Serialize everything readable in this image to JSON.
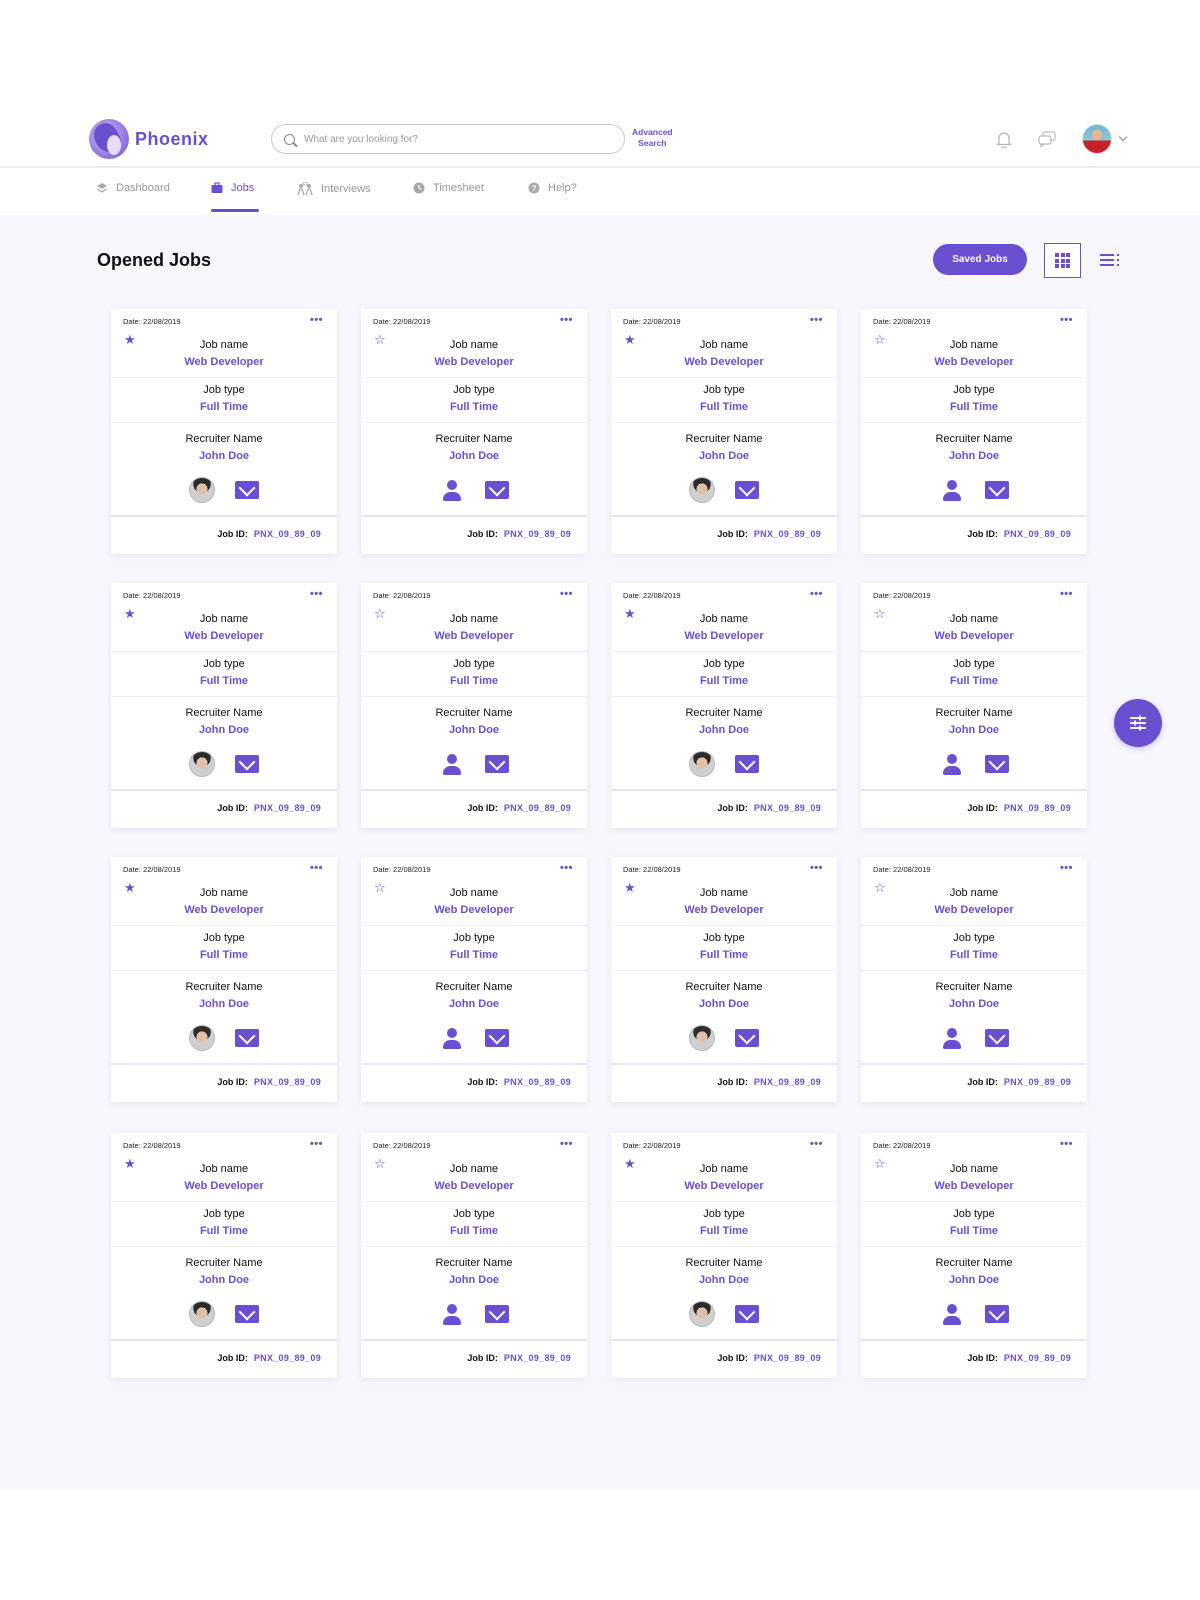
{
  "app": {
    "name": "Phoenix"
  },
  "header": {
    "search_placeholder": "What are you looking for?",
    "advanced_search_line1": "Advanced",
    "advanced_search_line2": "Search",
    "icons": [
      "bell-icon",
      "chat-icon",
      "user-avatar",
      "chevron-down-icon"
    ]
  },
  "nav": {
    "items": [
      {
        "label": "Dashboard",
        "icon": "layers-icon",
        "active": false
      },
      {
        "label": "Jobs",
        "icon": "briefcase-icon",
        "active": true
      },
      {
        "label": "Interviews",
        "icon": "interview-icon",
        "active": false
      },
      {
        "label": "Timesheet",
        "icon": "clock-icon",
        "active": false
      },
      {
        "label": "Help?",
        "icon": "help-icon",
        "active": false
      }
    ]
  },
  "page": {
    "title": "Opened Jobs",
    "saved_jobs_label": "Saved Jobs",
    "view_modes": [
      "grid",
      "list"
    ],
    "active_view": "grid"
  },
  "card_labels": {
    "date_prefix": "Date:",
    "job_name": "Job name",
    "job_type": "Job type",
    "recruiter_name": "Recruiter Name",
    "job_id": "Job ID:"
  },
  "cards": [
    {
      "date": "22/08/2019",
      "starred": true,
      "job_name": "Web Developer",
      "job_type": "Full Time",
      "recruiter": "John Doe",
      "recruiter_avatar": "photo",
      "job_id": "PNX_09_89_09"
    },
    {
      "date": "22/08/2019",
      "starred": false,
      "job_name": "Web Developer",
      "job_type": "Full Time",
      "recruiter": "John Doe",
      "recruiter_avatar": "user-icon",
      "job_id": "PNX_09_89_09"
    },
    {
      "date": "22/08/2019",
      "starred": true,
      "job_name": "Web Developer",
      "job_type": "Full Time",
      "recruiter": "John Doe",
      "recruiter_avatar": "photo",
      "job_id": "PNX_09_89_09"
    },
    {
      "date": "22/08/2019",
      "starred": false,
      "job_name": "Web Developer",
      "job_type": "Full Time",
      "recruiter": "John Doe",
      "recruiter_avatar": "user-icon",
      "job_id": "PNX_09_89_09"
    },
    {
      "date": "22/08/2019",
      "starred": true,
      "job_name": "Web Developer",
      "job_type": "Full Time",
      "recruiter": "John Doe",
      "recruiter_avatar": "photo",
      "job_id": "PNX_09_89_09"
    },
    {
      "date": "22/08/2019",
      "starred": false,
      "job_name": "Web Developer",
      "job_type": "Full Time",
      "recruiter": "John Doe",
      "recruiter_avatar": "user-icon",
      "job_id": "PNX_09_89_09"
    },
    {
      "date": "22/08/2019",
      "starred": true,
      "job_name": "Web Developer",
      "job_type": "Full Time",
      "recruiter": "John Doe",
      "recruiter_avatar": "photo",
      "job_id": "PNX_09_89_09"
    },
    {
      "date": "22/08/2019",
      "starred": false,
      "job_name": "Web Developer",
      "job_type": "Full Time",
      "recruiter": "John Doe",
      "recruiter_avatar": "user-icon",
      "job_id": "PNX_09_89_09"
    },
    {
      "date": "22/08/2019",
      "starred": true,
      "job_name": "Web Developer",
      "job_type": "Full Time",
      "recruiter": "John Doe",
      "recruiter_avatar": "photo",
      "job_id": "PNX_09_89_09"
    },
    {
      "date": "22/08/2019",
      "starred": false,
      "job_name": "Web Developer",
      "job_type": "Full Time",
      "recruiter": "John Doe",
      "recruiter_avatar": "user-icon",
      "job_id": "PNX_09_89_09"
    },
    {
      "date": "22/08/2019",
      "starred": true,
      "job_name": "Web Developer",
      "job_type": "Full Time",
      "recruiter": "John Doe",
      "recruiter_avatar": "photo",
      "job_id": "PNX_09_89_09"
    },
    {
      "date": "22/08/2019",
      "starred": false,
      "job_name": "Web Developer",
      "job_type": "Full Time",
      "recruiter": "John Doe",
      "recruiter_avatar": "user-icon",
      "job_id": "PNX_09_89_09"
    },
    {
      "date": "22/08/2019",
      "starred": true,
      "job_name": "Web Developer",
      "job_type": "Full Time",
      "recruiter": "John Doe",
      "recruiter_avatar": "photo",
      "job_id": "PNX_09_89_09"
    },
    {
      "date": "22/08/2019",
      "starred": false,
      "job_name": "Web Developer",
      "job_type": "Full Time",
      "recruiter": "John Doe",
      "recruiter_avatar": "user-icon",
      "job_id": "PNX_09_89_09"
    },
    {
      "date": "22/08/2019",
      "starred": true,
      "job_name": "Web Developer",
      "job_type": "Full Time",
      "recruiter": "John Doe",
      "recruiter_avatar": "photo",
      "job_id": "PNX_09_89_09"
    },
    {
      "date": "22/08/2019",
      "starred": false,
      "job_name": "Web Developer",
      "job_type": "Full Time",
      "recruiter": "John Doe",
      "recruiter_avatar": "user-icon",
      "job_id": "PNX_09_89_09"
    }
  ],
  "fab": {
    "icon": "filter-sliders-icon"
  },
  "colors": {
    "accent": "#6a4fd1",
    "background": "#f7f7fd",
    "muted_text": "#999999"
  }
}
